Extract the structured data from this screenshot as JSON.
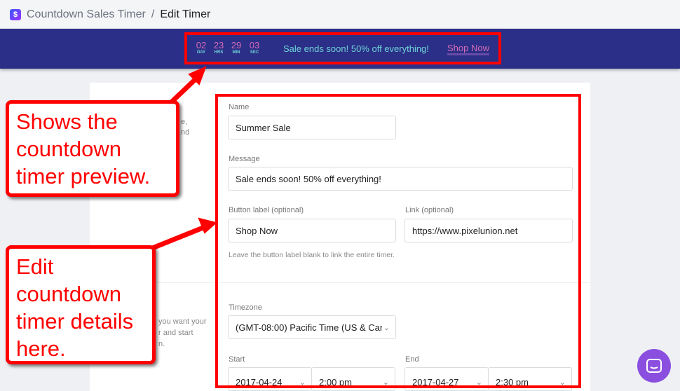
{
  "breadcrumb": {
    "app": "Countdown Sales Timer",
    "separator": "/",
    "current": "Edit Timer"
  },
  "preview": {
    "countdown": [
      {
        "value": "02",
        "unit": "DAY"
      },
      {
        "value": "23",
        "unit": "HRS"
      },
      {
        "value": "29",
        "unit": "MIN"
      },
      {
        "value": "03",
        "unit": "SEC"
      }
    ],
    "message": "Sale ends soon! 50% off everything!",
    "button": "Shop Now",
    "colors": {
      "background": "#2b2f87",
      "numbers": "#d66bb8",
      "text": "#6fd3d8"
    }
  },
  "left_fragments": [
    "e,",
    "nd",
    "you want your",
    "r and start",
    "n."
  ],
  "form": {
    "name_label": "Name",
    "name_value": "Summer Sale",
    "message_label": "Message",
    "message_value": "Sale ends soon! 50% off everything!",
    "button_label_label": "Button label (optional)",
    "button_label_value": "Shop Now",
    "link_label": "Link (optional)",
    "link_value": "https://www.pixelunion.net",
    "help": "Leave the button label blank to link the entire timer.",
    "timezone_label": "Timezone",
    "timezone_value": "(GMT-08:00) Pacific Time (US & Can",
    "start_label": "Start",
    "start_date": "2017-04-24",
    "start_time": "2:00 pm",
    "end_label": "End",
    "end_date": "2017-04-27",
    "end_time": "2:30 pm"
  },
  "annotations": {
    "preview": "Shows the countdown timer preview.",
    "details": "Edit countdown timer details here."
  }
}
